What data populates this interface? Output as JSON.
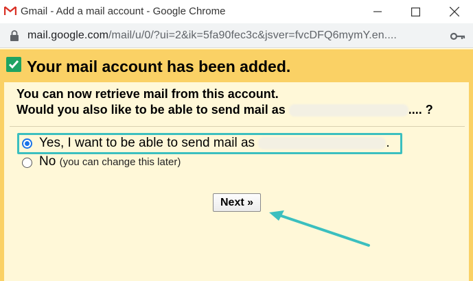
{
  "window": {
    "title": "Gmail - Add a mail account - Google Chrome",
    "minimize_glyph": "—",
    "maximize_glyph": "☐",
    "close_glyph": "✕"
  },
  "address_bar": {
    "host": "mail.google.com",
    "path": "/mail/u/0/?ui=2&ik=5fa90fec3c&jsver=fvcDFQ6mymY.en...."
  },
  "header": {
    "title": "Your mail account has been added."
  },
  "message": {
    "line1": "You can now retrieve mail from this account.",
    "line2_prefix": "Would you also like to be able to send mail as ",
    "line2_tail": ".... ?"
  },
  "options": {
    "yes_label": "Yes, I want to be able to send mail as ",
    "yes_tail": ".",
    "yes_selected": true,
    "no_label": "No",
    "no_hint": "(you can change this later)"
  },
  "buttons": {
    "next_label": "Next »"
  },
  "colors": {
    "header_bg": "#fad165",
    "page_bg": "#fff8d8",
    "highlight_border": "#3bbfbf",
    "arrow": "#3bbfbf",
    "check_bg": "#1ea362"
  }
}
